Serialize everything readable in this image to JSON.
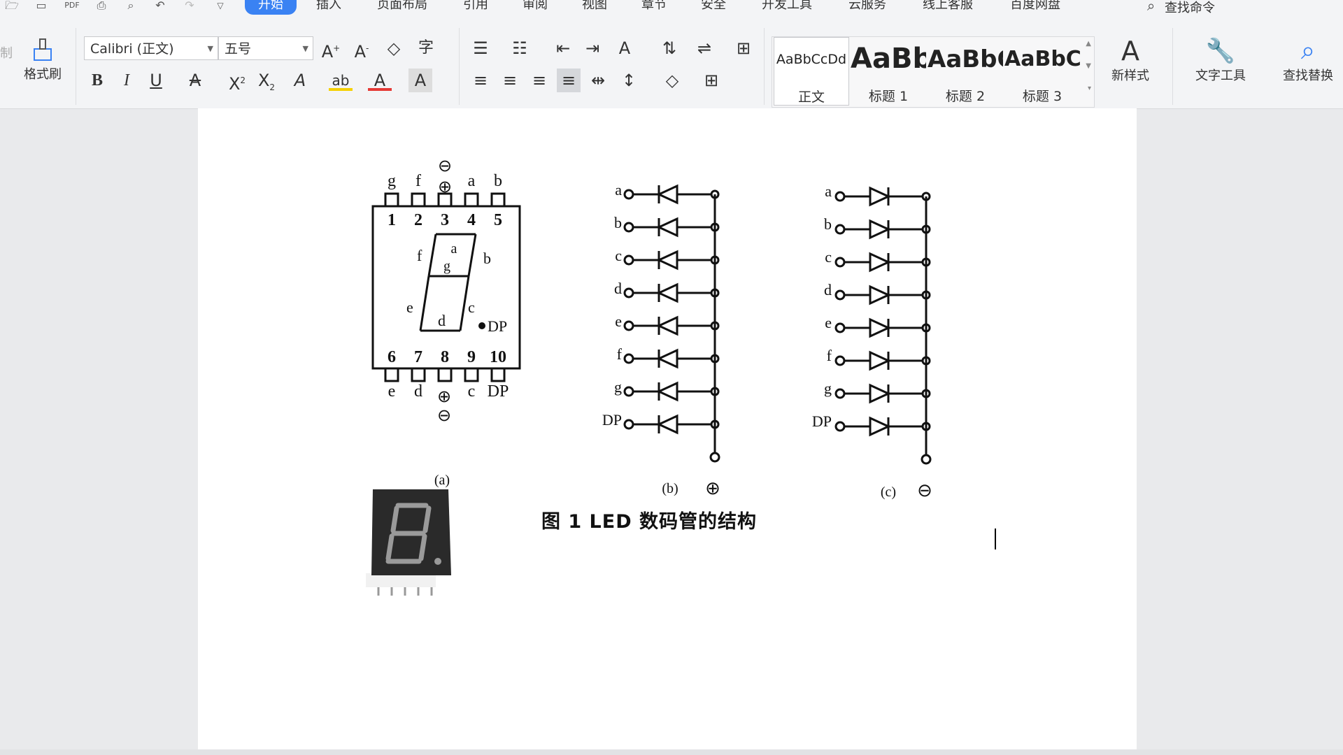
{
  "menu": {
    "tabs": [
      "开始",
      "插入",
      "页面布局",
      "引用",
      "审阅",
      "视图",
      "章节",
      "安全",
      "开发工具",
      "云服务",
      "线上客服",
      "百度网盘"
    ],
    "active_tab": "开始",
    "find_command": "查找命令"
  },
  "ribbon": {
    "format_painter": "格式刷",
    "font_name": "Calibri (正文)",
    "font_size": "五号",
    "styles": [
      {
        "preview": "AaBbCcDd",
        "name": "正文"
      },
      {
        "preview": "AaBb",
        "name": "标题 1"
      },
      {
        "preview": "AaBbC",
        "name": "标题 2"
      },
      {
        "preview": "AaBbC",
        "name": "标题 3"
      }
    ],
    "new_style": "新样式",
    "text_tools": "文字工具",
    "find_replace": "查找替换"
  },
  "figure": {
    "caption": "图 1  LED 数码管的结构",
    "panel_labels": [
      "(a)",
      "(b)",
      "(c)"
    ],
    "pkg_top_letters": [
      "g",
      "f",
      "a",
      "b"
    ],
    "pkg_top_numbers": [
      "1",
      "2",
      "3",
      "4",
      "5"
    ],
    "pkg_bottom_numbers": [
      "6",
      "7",
      "8",
      "9",
      "10"
    ],
    "pkg_bottom_letters": [
      "e",
      "d",
      "c",
      "DP"
    ],
    "pkg_segments": [
      "a",
      "b",
      "c",
      "d",
      "e",
      "f",
      "g"
    ],
    "pkg_dp": "DP",
    "pin_labels": [
      "a",
      "b",
      "c",
      "d",
      "e",
      "f",
      "g",
      "DP"
    ],
    "plus_symbol": "⊕",
    "minus_symbol": "⊖"
  },
  "colors": {
    "accent": "#3a82f3",
    "ribbon_bg": "#f3f4f6",
    "canvas_bg": "#e9eaec"
  }
}
